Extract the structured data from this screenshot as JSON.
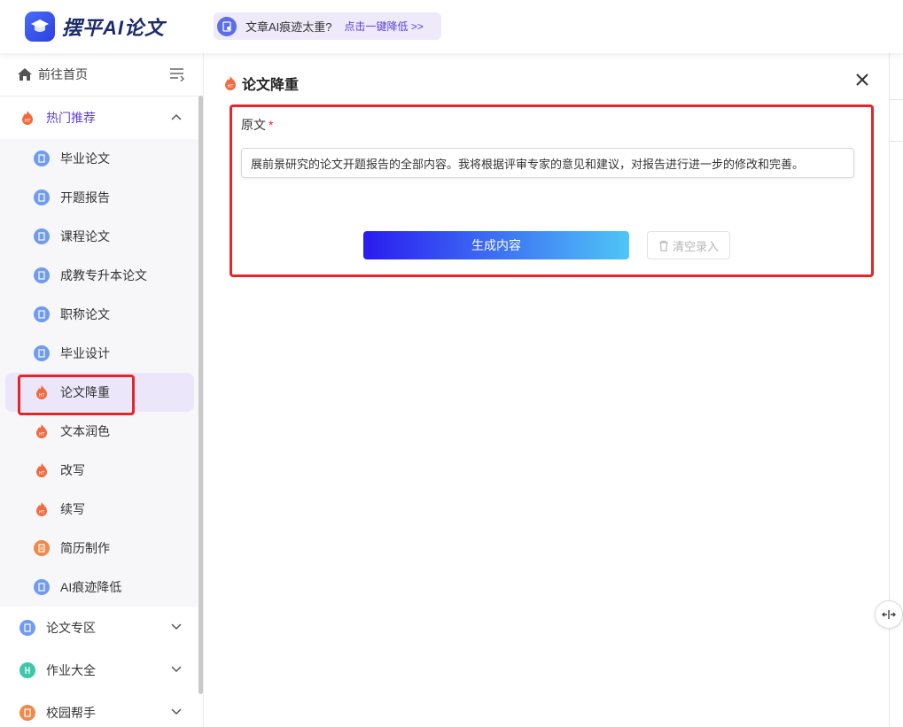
{
  "header": {
    "logo_text": "摆平AI论文",
    "notice_text": "文章AI痕迹太重?",
    "notice_link": "点击一键降低 >>"
  },
  "sidebar": {
    "home_label": "前往首页",
    "hot_group": {
      "label": "热门推荐",
      "items": [
        {
          "label": "毕业论文",
          "icon": "document-icon"
        },
        {
          "label": "开题报告",
          "icon": "document-icon"
        },
        {
          "label": "课程论文",
          "icon": "document-icon"
        },
        {
          "label": "成教专升本论文",
          "icon": "document-icon"
        },
        {
          "label": "职称论文",
          "icon": "document-icon"
        },
        {
          "label": "毕业设计",
          "icon": "document-icon"
        },
        {
          "label": "论文降重",
          "icon": "hot-flame-icon"
        },
        {
          "label": "文本润色",
          "icon": "hot-flame-icon"
        },
        {
          "label": "改写",
          "icon": "hot-flame-icon"
        },
        {
          "label": "续写",
          "icon": "hot-flame-icon"
        },
        {
          "label": "简历制作",
          "icon": "resume-icon"
        },
        {
          "label": "AI痕迹降低",
          "icon": "document-icon"
        }
      ]
    },
    "groups": [
      {
        "label": "论文专区",
        "icon": "document-icon"
      },
      {
        "label": "作业大全",
        "icon": "homework-icon"
      },
      {
        "label": "校园帮手",
        "icon": "campus-icon"
      }
    ]
  },
  "main": {
    "title": "论文降重",
    "field_label": "原文",
    "required_mark": "*",
    "input_value": "展前景研究的论文开题报告的全部内容。我将根据评审专家的意见和建议，对报告进行进一步的修改和完善。",
    "generate_label": "生成内容",
    "clear_label": "清空录入"
  },
  "colors": {
    "accent": "#5b3fd8",
    "highlight": "#e5252a",
    "selected_bg": "#ece6fb"
  }
}
